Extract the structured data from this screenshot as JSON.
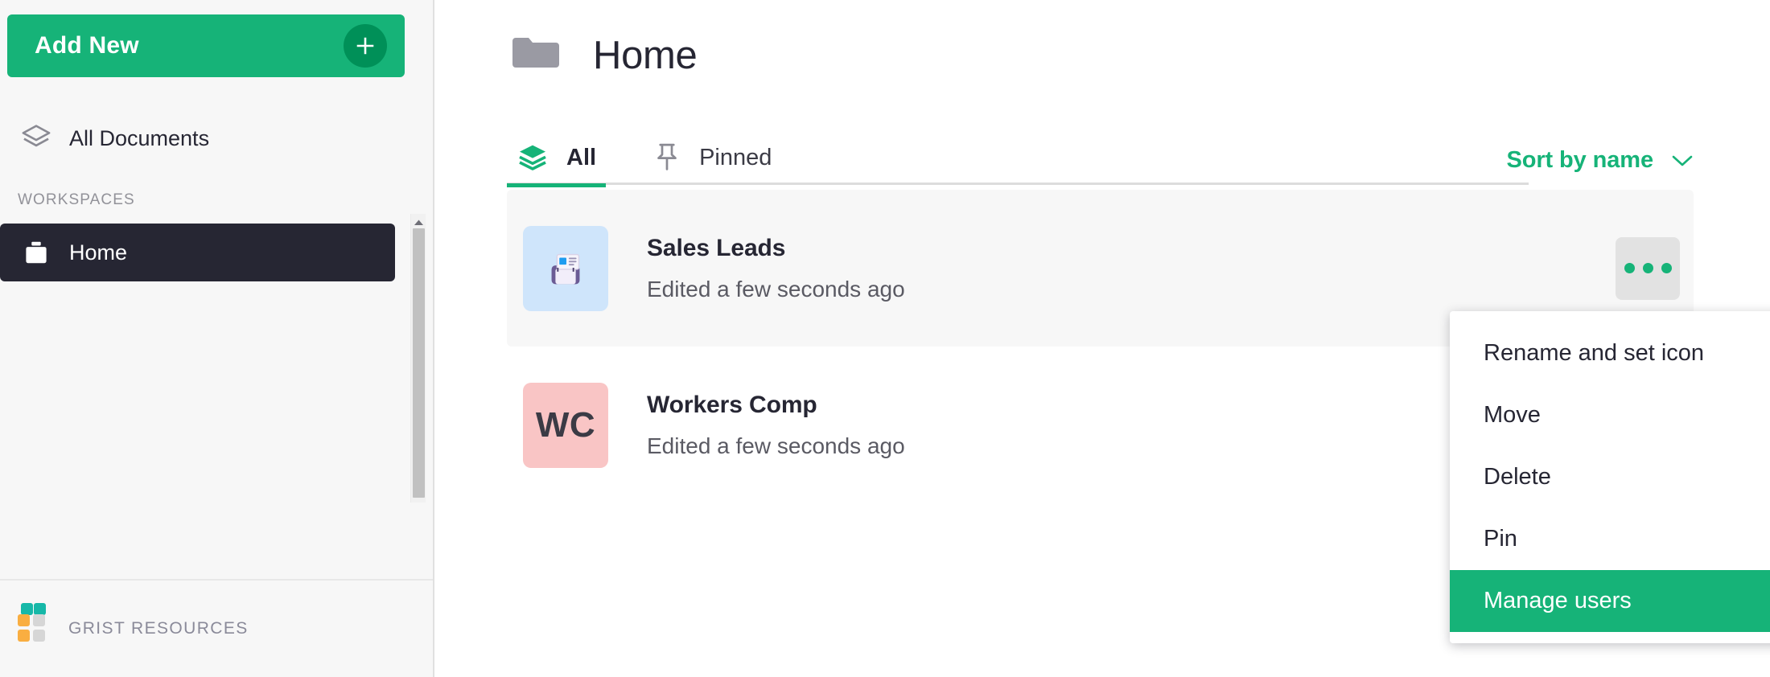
{
  "colors": {
    "brand_green": "#16b378",
    "brand_green_dark": "#009058",
    "sidebar_bg": "#f7f7f7",
    "active_nav_bg": "#262633",
    "row_hover_bg": "#f7f7f7",
    "menu_selected_bg": "#16b378",
    "sales_leads_icon_bg": "#cfe5fb",
    "workers_comp_icon_bg": "#f9c5c5"
  },
  "sidebar": {
    "add_new": {
      "label": "Add New",
      "icon": "plus-icon"
    },
    "nav_items": [
      {
        "label": "All Documents",
        "icon": "layers-icon",
        "active": false
      }
    ],
    "workspaces_heading": "Workspaces",
    "workspaces": [
      {
        "label": "Home",
        "icon": "briefcase-icon",
        "active": true
      }
    ],
    "footer": {
      "label": "Grist Resources",
      "icon": "grist-logo-icon"
    },
    "scrollbar": {
      "up_arrow_icon": "caret-up-icon"
    }
  },
  "main": {
    "header": {
      "icon": "folder-icon",
      "title": "Home"
    },
    "tabs": [
      {
        "label": "All",
        "icon": "layers-icon",
        "active": true
      },
      {
        "label": "Pinned",
        "icon": "pin-icon",
        "active": false
      }
    ],
    "sort": {
      "label": "Sort by name",
      "icon": "chevron-down-icon"
    },
    "documents": [
      {
        "name": "Sales Leads",
        "meta": "Edited a few seconds ago",
        "icon_type": "emoji",
        "icon_emoji": "🗞",
        "icon_bg": "#cfe5fb",
        "hovered": true,
        "menu_icon": "ellipsis-icon"
      },
      {
        "name": "Workers Comp",
        "meta": "Edited a few seconds ago",
        "icon_type": "initials",
        "icon_initials": "WC",
        "icon_bg": "#f9c5c5",
        "hovered": false,
        "menu_icon": "ellipsis-icon"
      }
    ]
  },
  "context_menu": {
    "items": [
      {
        "label": "Rename and set icon",
        "selected": false
      },
      {
        "label": "Move",
        "selected": false
      },
      {
        "label": "Delete",
        "selected": false
      },
      {
        "label": "Pin",
        "selected": false
      },
      {
        "label": "Manage users",
        "selected": true
      }
    ]
  }
}
